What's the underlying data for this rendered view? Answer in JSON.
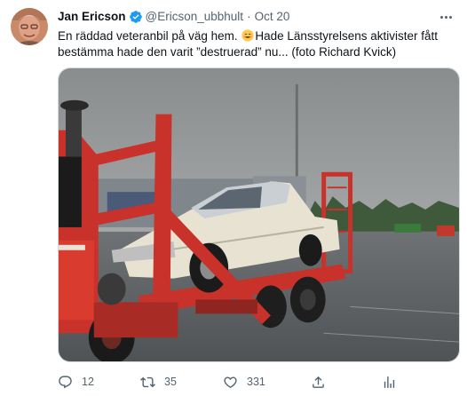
{
  "tweet": {
    "author": {
      "name": "Jan Ericson",
      "handle": "@Ericson_ubbhult",
      "verified": true
    },
    "separator": "·",
    "date": "Oct 20",
    "text_line_1a": "En räddad veteranbil på väg hem. ",
    "text_line_1b": "Hade Länsstyrelsens aktivister fått",
    "text_line_2": "bestämma hade den varit ”destruerad” nu... (foto Richard  Kvick)",
    "emoji": "smiling-face-emoji",
    "media": {
      "icon": "photo-red-car-transporter-carrying-vintage-car"
    },
    "actions": {
      "reply_count": "12",
      "retweet_count": "35",
      "like_count": "331"
    }
  },
  "colors": {
    "text": "#0f1419",
    "secondary": "#536471",
    "verified": "#1d9bf0",
    "border": "#cfd9de"
  }
}
